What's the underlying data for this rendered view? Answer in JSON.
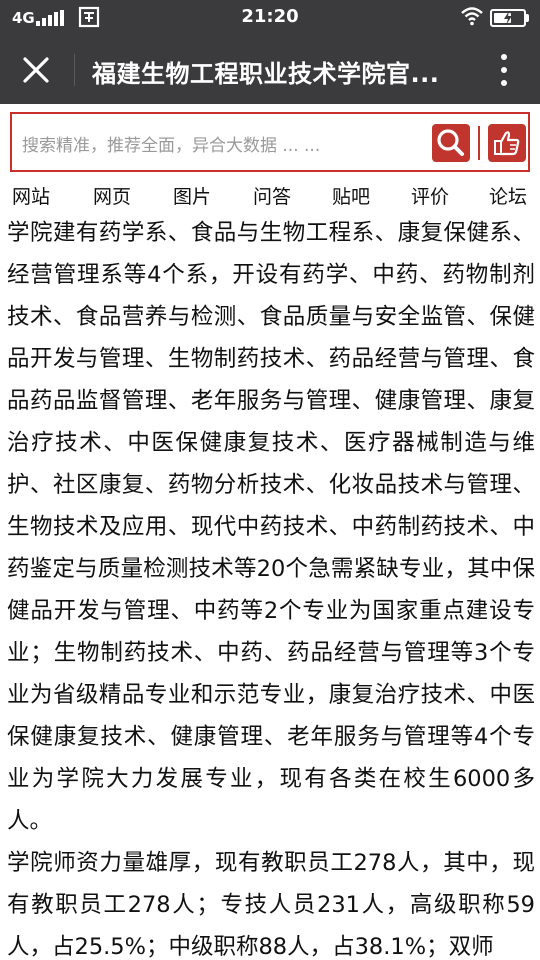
{
  "status_bar": {
    "network": "4G",
    "time": "21:20",
    "battery_level": 0.6
  },
  "title_bar": {
    "title": "福建生物工程职业技术学院官..."
  },
  "search": {
    "placeholder": "搜索精准，推荐全面，异合大数据 ... ..."
  },
  "nav": {
    "items": [
      {
        "label": "网站"
      },
      {
        "label": "网页"
      },
      {
        "label": "图片"
      },
      {
        "label": "问答"
      },
      {
        "label": "贴吧"
      },
      {
        "label": "评价"
      },
      {
        "label": "论坛"
      }
    ]
  },
  "article": {
    "paragraphs": [
      "学院建有药学系、食品与生物工程系、康复保健系、经营管理系等4个系，开设有药学、中药、药物制剂技术、食品营养与检测、食品质量与安全监管、保健品开发与管理、生物制药技术、药品经营与管理、食品药品监督管理、老年服务与管理、健康管理、康复治疗技术、中医保健康复技术、医疗器械制造与维护、社区康复、药物分析技术、化妆品技术与管理、生物技术及应用、现代中药技术、中药制药技术、中药鉴定与质量检测技术等20个急需紧缺专业，其中保健品开发与管理、中药等2个专业为国家重点建设专业；生物制药技术、中药、药品经营与管理等3个专业为省级精品专业和示范专业，康复治疗技术、中医保健康复技术、健康管理、老年服务与管理等4个专业为学院大力发展专业，现有各类在校生6000多人。",
      "学院师资力量雄厚，现有教职员工278人，其中，现有教职员工278人；专技人员231人，高级职称59人，占25.5%；中级职称88人，占38.1%；双师"
    ]
  },
  "icons": {
    "close": "close-icon",
    "more": "more-vertical-icon",
    "search": "search-icon",
    "like": "thumbs-up-icon"
  },
  "colors": {
    "bar_bg": "#3b3b3d",
    "accent_red": "#c0352d"
  }
}
